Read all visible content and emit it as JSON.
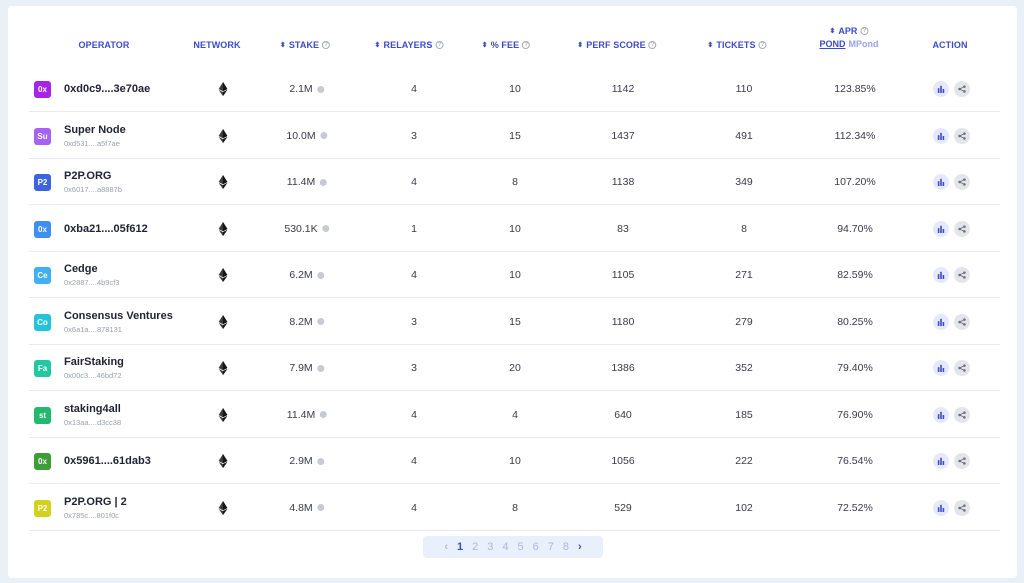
{
  "header": {
    "operator": "OPERATOR",
    "network": "NETWORK",
    "stake": "STAKE",
    "relayers": "RELAYERS",
    "fee": "% FEE",
    "perf": "PERF SCORE",
    "tickets": "TICKETS",
    "apr": "APR",
    "apr_unit_pond": "POND",
    "apr_unit_mpond": "MPond",
    "action": "ACTION"
  },
  "icons": {
    "sort": "sort-arrows-icon",
    "help": "help-circle-icon",
    "network": "ethereum-icon",
    "info": "info-dot-icon",
    "chart": "bar-chart-icon",
    "share": "share-icon"
  },
  "colors": {
    "accent": "#3b4cc8",
    "background": "#e9f0f6"
  },
  "rows": [
    {
      "initials": "0x",
      "color": "#a624e8",
      "name": "0xd0c9....3e70ae",
      "address": "",
      "stake": "2.1M",
      "relayers": "4",
      "fee": "10",
      "perf": "1142",
      "tickets": "110",
      "apr": "123.85%"
    },
    {
      "initials": "Su",
      "color": "#a562f4",
      "name": "Super Node",
      "address": "0xd531....a5f7ae",
      "stake": "10.0M",
      "relayers": "3",
      "fee": "15",
      "perf": "1437",
      "tickets": "491",
      "apr": "112.34%"
    },
    {
      "initials": "P2",
      "color": "#3a64e0",
      "name": "P2P.ORG",
      "address": "0x6017....a8887b",
      "stake": "11.4M",
      "relayers": "4",
      "fee": "8",
      "perf": "1138",
      "tickets": "349",
      "apr": "107.20%"
    },
    {
      "initials": "0x",
      "color": "#3f8ff0",
      "name": "0xba21....05f612",
      "address": "",
      "stake": "530.1K",
      "relayers": "1",
      "fee": "10",
      "perf": "83",
      "tickets": "8",
      "apr": "94.70%"
    },
    {
      "initials": "Ce",
      "color": "#3fb1f2",
      "name": "Cedge",
      "address": "0x2887....4b9cf3",
      "stake": "6.2M",
      "relayers": "4",
      "fee": "10",
      "perf": "1105",
      "tickets": "271",
      "apr": "82.59%"
    },
    {
      "initials": "Co",
      "color": "#25c3d8",
      "name": "Consensus Ventures",
      "address": "0x6a1a....878131",
      "stake": "8.2M",
      "relayers": "3",
      "fee": "15",
      "perf": "1180",
      "tickets": "279",
      "apr": "80.25%"
    },
    {
      "initials": "Fa",
      "color": "#22c9a0",
      "name": "FairStaking",
      "address": "0x00c3....46bd72",
      "stake": "7.9M",
      "relayers": "3",
      "fee": "20",
      "perf": "1386",
      "tickets": "352",
      "apr": "79.40%"
    },
    {
      "initials": "st",
      "color": "#22b86d",
      "name": "staking4all",
      "address": "0x13aa....d3cc38",
      "stake": "11.4M",
      "relayers": "4",
      "fee": "4",
      "perf": "640",
      "tickets": "185",
      "apr": "76.90%"
    },
    {
      "initials": "0x",
      "color": "#3f9d35",
      "name": "0x5961....61dab3",
      "address": "",
      "stake": "2.9M",
      "relayers": "4",
      "fee": "10",
      "perf": "1056",
      "tickets": "222",
      "apr": "76.54%"
    },
    {
      "initials": "P2",
      "color": "#d3d11c",
      "name": "P2P.ORG | 2",
      "address": "0x785c....801f0c",
      "stake": "4.8M",
      "relayers": "4",
      "fee": "8",
      "perf": "529",
      "tickets": "102",
      "apr": "72.52%"
    }
  ],
  "pagination": {
    "prev": "‹",
    "next": "›",
    "pages": [
      "1",
      "2",
      "3",
      "4",
      "5",
      "6",
      "7",
      "8"
    ],
    "current": "1"
  }
}
